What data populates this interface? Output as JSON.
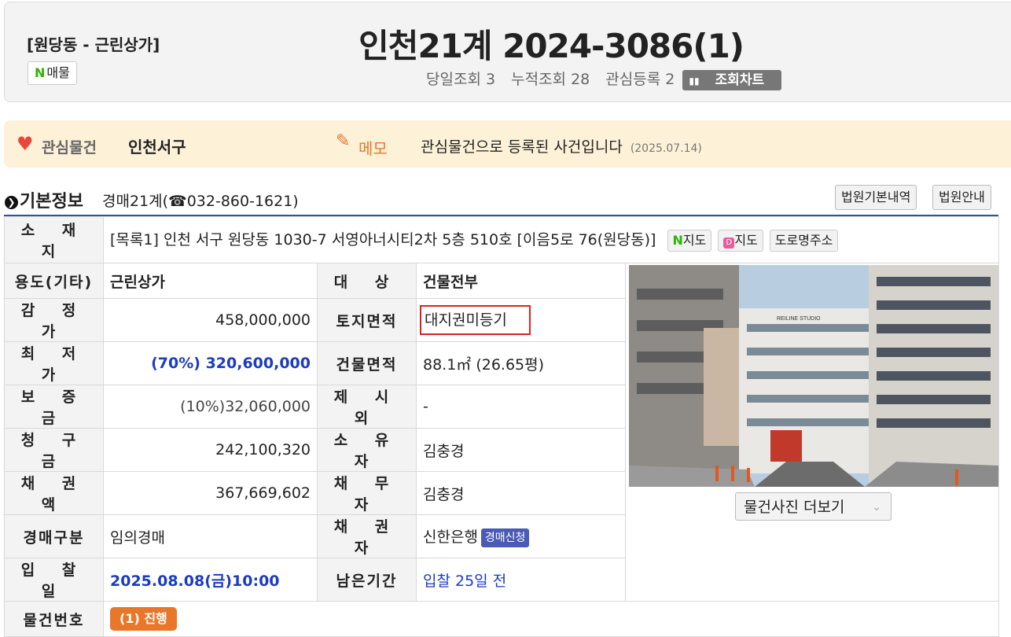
{
  "header": {
    "region": "[원당동 - 근린상가]",
    "n_badge_letter": "N",
    "n_badge_label": "매물",
    "title": "인천21계 2024-3086(1)",
    "stats": {
      "today_views": "당일조회 3",
      "total_views": "누적조회 28",
      "interest": "관심등록 2",
      "chart_button": "조회차트"
    }
  },
  "favorite": {
    "label": "관심물건",
    "value": "인천서구",
    "memo_label": "메모",
    "memo_text": "관심물건으로 등록된 사건입니다",
    "memo_date": "(2025.07.14)"
  },
  "section": {
    "title": "기본정보",
    "court": "경매21계(☎032-860-1621)",
    "buttons": [
      "법원기본내역",
      "법원안내"
    ]
  },
  "info": {
    "location_label": "소 재 지",
    "location_value": "[목록1] 인천 서구 원당동 1030-7 서영아너시티2차 5층 510호 [이음5로 76(원당동)]",
    "map_buttons": {
      "naver_letter": "N",
      "naver": "지도",
      "daum_letter": "D",
      "daum": "지도",
      "road": "도로명주소"
    },
    "usage_label": "용도(기타)",
    "usage_value": "근린상가",
    "target_label": "대 상",
    "target_value": "건물전부",
    "appraisal_label": "감 정 가",
    "appraisal_value": "458,000,000",
    "land_label": "토지면적",
    "land_value": "대지권미등기",
    "minimum_label": "최 저 가",
    "minimum_value": "(70%) 320,600,000",
    "building_label": "건물면적",
    "building_value": "88.1㎡ (26.65평)",
    "deposit_label": "보 증 금",
    "deposit_value": "(10%)32,060,000",
    "exclusion_label": "제 시 외",
    "exclusion_value": "-",
    "claim_label": "청 구 금",
    "claim_value": "242,100,320",
    "owner_label": "소 유 자",
    "owner_value": "김충경",
    "credit_label": "채 권 액",
    "credit_value": "367,669,602",
    "debtor_label": "채 무 자",
    "debtor_value": "김충경",
    "type_label": "경매구분",
    "type_value": "임의경매",
    "creditor_label": "채 권 자",
    "creditor_value": "신한은행",
    "creditor_badge": "경매신청",
    "bid_label": "입 찰 일",
    "bid_value": "2025.08.08(금)10:00",
    "remain_label": "남은기간",
    "remain_value": "입찰 25일 전",
    "itemno_label": "물건번호",
    "itemno_badge": "(1) 진행"
  },
  "photo": {
    "more_button": "물건사진 더보기",
    "sign_text": "REILINE STUDIO"
  }
}
